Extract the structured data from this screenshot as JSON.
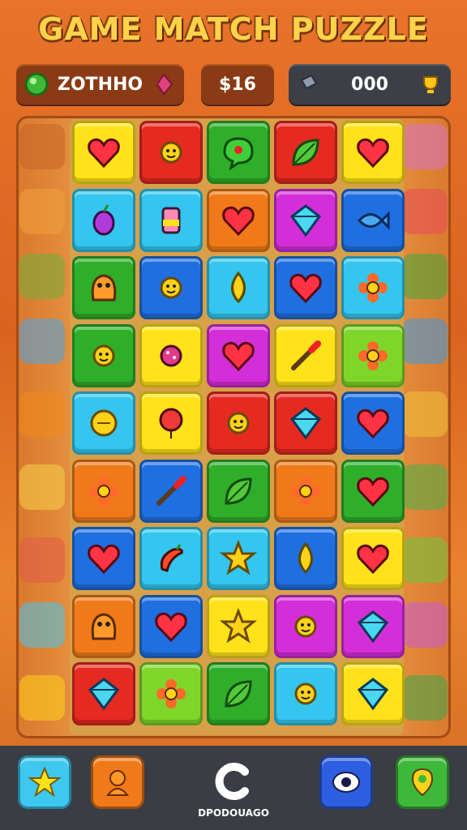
{
  "title": "GAME MATCH PUZZLE",
  "hud": {
    "left_value": "ZOTHHO",
    "center_value": "$16",
    "right_value": "000"
  },
  "colors": {
    "red": "#e52a22",
    "yellow": "#ffe21a",
    "green": "#2fae2a",
    "cyan": "#34c6ee",
    "blue": "#1f6fe0",
    "orange": "#f07a1a",
    "magenta": "#d42ed8",
    "lime": "#7fd62a"
  },
  "grid": [
    [
      {
        "c": "yellow",
        "i": "heart-icon"
      },
      {
        "c": "red",
        "i": "sun-icon"
      },
      {
        "c": "green",
        "i": "bubble-icon"
      },
      {
        "c": "red",
        "i": "leaf-icon"
      },
      {
        "c": "yellow",
        "i": "heart-icon"
      }
    ],
    [
      {
        "c": "cyan",
        "i": "berry-icon"
      },
      {
        "c": "cyan",
        "i": "potion-icon"
      },
      {
        "c": "orange",
        "i": "heart-icon"
      },
      {
        "c": "magenta",
        "i": "gem-icon"
      },
      {
        "c": "blue",
        "i": "fish-icon"
      }
    ],
    [
      {
        "c": "green",
        "i": "monster-icon"
      },
      {
        "c": "blue",
        "i": "sun-icon"
      },
      {
        "c": "cyan",
        "i": "drop-icon"
      },
      {
        "c": "blue",
        "i": "heart-icon"
      },
      {
        "c": "cyan",
        "i": "flower-icon"
      }
    ],
    [
      {
        "c": "green",
        "i": "sun-icon"
      },
      {
        "c": "yellow",
        "i": "candy-icon"
      },
      {
        "c": "magenta",
        "i": "heart-icon"
      },
      {
        "c": "yellow",
        "i": "brush-icon"
      },
      {
        "c": "lime",
        "i": "flower-icon"
      }
    ],
    [
      {
        "c": "cyan",
        "i": "coin-icon"
      },
      {
        "c": "yellow",
        "i": "balloon-icon"
      },
      {
        "c": "red",
        "i": "sun-icon"
      },
      {
        "c": "red",
        "i": "gem-icon"
      },
      {
        "c": "blue",
        "i": "heart-icon"
      }
    ],
    [
      {
        "c": "orange",
        "i": "flower-icon"
      },
      {
        "c": "blue",
        "i": "brush-icon"
      },
      {
        "c": "green",
        "i": "leaf-icon"
      },
      {
        "c": "orange",
        "i": "flower-icon"
      },
      {
        "c": "green",
        "i": "heart-icon"
      }
    ],
    [
      {
        "c": "blue",
        "i": "heart-icon"
      },
      {
        "c": "cyan",
        "i": "pepper-icon"
      },
      {
        "c": "cyan",
        "i": "star-icon"
      },
      {
        "c": "blue",
        "i": "drop-icon"
      },
      {
        "c": "yellow",
        "i": "heart-icon"
      }
    ],
    [
      {
        "c": "orange",
        "i": "monster-icon"
      },
      {
        "c": "blue",
        "i": "heart-icon"
      },
      {
        "c": "yellow",
        "i": "star-icon"
      },
      {
        "c": "magenta",
        "i": "sun-icon"
      },
      {
        "c": "magenta",
        "i": "gem-icon"
      }
    ],
    [
      {
        "c": "red",
        "i": "gem-icon"
      },
      {
        "c": "lime",
        "i": "flower-icon"
      },
      {
        "c": "green",
        "i": "leaf-icon"
      },
      {
        "c": "cyan",
        "i": "sun-icon"
      },
      {
        "c": "yellow",
        "i": "gem-icon"
      }
    ]
  ],
  "bottom_bar": {
    "logo_text": "DPODOUAGO"
  }
}
